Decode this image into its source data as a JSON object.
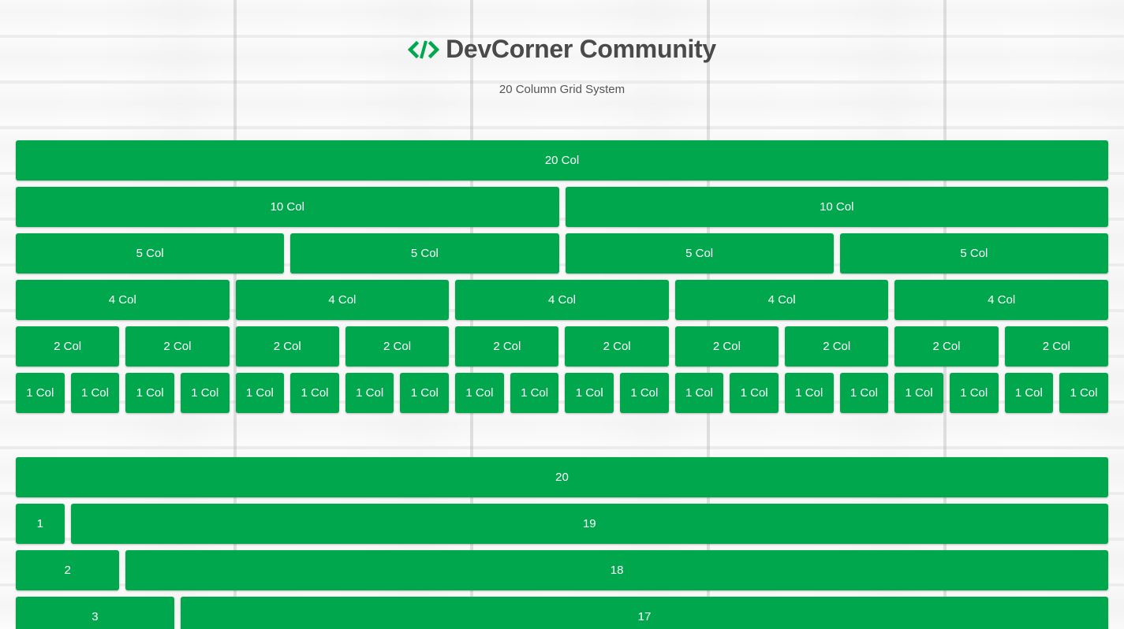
{
  "header": {
    "title": "DevCorner Community",
    "subtitle": "20 Column Grid System",
    "logo_icon": "code-brackets-icon",
    "logo_color": "#00a74c"
  },
  "colors": {
    "cell_background": "#00a74c",
    "cell_text": "#ffffff",
    "title_text": "#4a4a4a"
  },
  "grid_top": {
    "rows": [
      [
        {
          "span": 20,
          "label": "20 Col"
        }
      ],
      [
        {
          "span": 10,
          "label": "10 Col"
        },
        {
          "span": 10,
          "label": "10 Col"
        }
      ],
      [
        {
          "span": 5,
          "label": "5 Col"
        },
        {
          "span": 5,
          "label": "5 Col"
        },
        {
          "span": 5,
          "label": "5 Col"
        },
        {
          "span": 5,
          "label": "5 Col"
        }
      ],
      [
        {
          "span": 4,
          "label": "4 Col"
        },
        {
          "span": 4,
          "label": "4 Col"
        },
        {
          "span": 4,
          "label": "4 Col"
        },
        {
          "span": 4,
          "label": "4 Col"
        },
        {
          "span": 4,
          "label": "4 Col"
        }
      ],
      [
        {
          "span": 2,
          "label": "2 Col"
        },
        {
          "span": 2,
          "label": "2 Col"
        },
        {
          "span": 2,
          "label": "2 Col"
        },
        {
          "span": 2,
          "label": "2 Col"
        },
        {
          "span": 2,
          "label": "2 Col"
        },
        {
          "span": 2,
          "label": "2 Col"
        },
        {
          "span": 2,
          "label": "2 Col"
        },
        {
          "span": 2,
          "label": "2 Col"
        },
        {
          "span": 2,
          "label": "2 Col"
        },
        {
          "span": 2,
          "label": "2 Col"
        }
      ],
      [
        {
          "span": 1,
          "label": "1 Col"
        },
        {
          "span": 1,
          "label": "1 Col"
        },
        {
          "span": 1,
          "label": "1 Col"
        },
        {
          "span": 1,
          "label": "1 Col"
        },
        {
          "span": 1,
          "label": "1 Col"
        },
        {
          "span": 1,
          "label": "1 Col"
        },
        {
          "span": 1,
          "label": "1 Col"
        },
        {
          "span": 1,
          "label": "1 Col"
        },
        {
          "span": 1,
          "label": "1 Col"
        },
        {
          "span": 1,
          "label": "1 Col"
        },
        {
          "span": 1,
          "label": "1 Col"
        },
        {
          "span": 1,
          "label": "1 Col"
        },
        {
          "span": 1,
          "label": "1 Col"
        },
        {
          "span": 1,
          "label": "1 Col"
        },
        {
          "span": 1,
          "label": "1 Col"
        },
        {
          "span": 1,
          "label": "1 Col"
        },
        {
          "span": 1,
          "label": "1 Col"
        },
        {
          "span": 1,
          "label": "1 Col"
        },
        {
          "span": 1,
          "label": "1 Col"
        },
        {
          "span": 1,
          "label": "1 Col"
        }
      ]
    ]
  },
  "grid_bottom": {
    "rows": [
      [
        {
          "span": 20,
          "label": "20"
        }
      ],
      [
        {
          "span": 1,
          "label": "1"
        },
        {
          "span": 19,
          "label": "19"
        }
      ],
      [
        {
          "span": 2,
          "label": "2"
        },
        {
          "span": 18,
          "label": "18"
        }
      ],
      [
        {
          "span": 3,
          "label": "3"
        },
        {
          "span": 17,
          "label": "17"
        }
      ]
    ]
  }
}
